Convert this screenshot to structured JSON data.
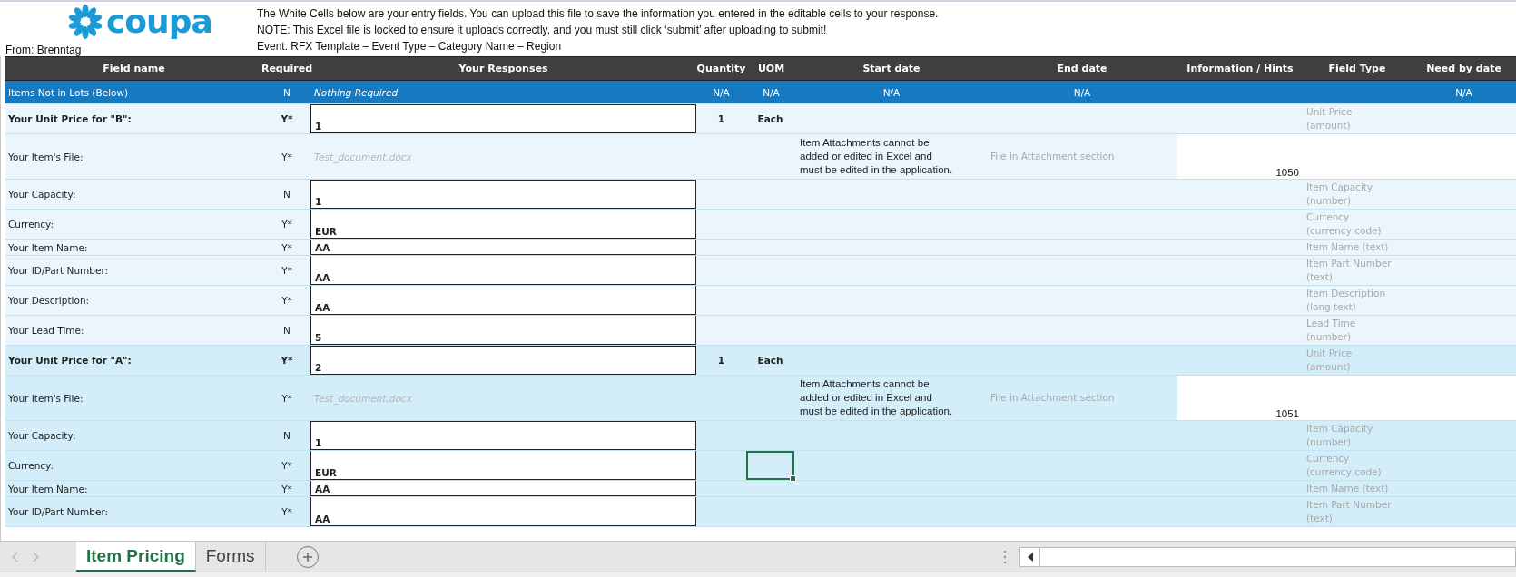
{
  "logo": {
    "text": "coupa"
  },
  "from": "From: Brenntag",
  "notes": [
    "The White Cells below are your entry fields. You can upload this file to save the information you entered in the editable cells to your response.",
    "NOTE: This Excel file is locked to ensure it uploads correctly, and you must still click ‘submit’ after uploading to submit!"
  ],
  "event": "Event: RFX Template – Event Type – Category Name – Region",
  "columns": [
    "Field name",
    "Required",
    "Your Responses",
    "Quantity",
    "UOM",
    "Start date",
    "End date",
    "Information / Hints",
    "Field Type",
    "Need by date"
  ],
  "lots_row": {
    "field": "Items Not in Lots (Below)",
    "required": "N",
    "response": "Nothing Required",
    "quantity": "N/A",
    "uom": "N/A",
    "start_date": "N/A",
    "end_date": "N/A",
    "need_by_date": "N/A"
  },
  "groups": [
    {
      "color": "#eaf6fc",
      "rows": [
        {
          "kind": "price",
          "label": "Your Unit Price for \"B\":",
          "required": "Y*",
          "response": "1",
          "quantity": "1",
          "uom": "Each",
          "field_type": "Unit Price\n(amount)",
          "selected": false
        },
        {
          "kind": "file",
          "label": "Your Item's File:",
          "required": "Y*",
          "file_name": "Test_document.docx",
          "note": "Item Attachments cannot be\nadded or edited in Excel and\nmust be edited in the application.",
          "hint": "File in Attachment section",
          "item_id": "1050",
          "selected": false
        },
        {
          "kind": "field",
          "label": "Your Capacity:",
          "required": "N",
          "response": "1",
          "field_type": "Item Capacity\n(number)",
          "selected": false
        },
        {
          "kind": "field",
          "label": "Currency:",
          "required": "Y*",
          "response": "EUR",
          "field_type": "Currency\n(currency code)",
          "selected": false
        },
        {
          "kind": "compact",
          "label": "Your Item Name:",
          "required": "Y*",
          "response": "AA",
          "field_type": "Item Name (text)",
          "selected": false
        },
        {
          "kind": "field",
          "label": "Your ID/Part Number:",
          "required": "Y*",
          "response": "AA",
          "field_type": "Item Part Number\n(text)",
          "selected": false
        },
        {
          "kind": "field",
          "label": "Your Description:",
          "required": "Y*",
          "response": "AA",
          "field_type": "Item Description\n(long text)",
          "selected": false
        },
        {
          "kind": "field",
          "label": "Your Lead Time:",
          "required": "N",
          "response": "5",
          "field_type": "Lead Time\n(number)",
          "selected": false
        }
      ]
    },
    {
      "color": "#d3eef9",
      "rows": [
        {
          "kind": "price",
          "label": "Your Unit Price for \"A\":",
          "required": "Y*",
          "response": "2",
          "quantity": "1",
          "uom": "Each",
          "field_type": "Unit Price\n(amount)",
          "selected": false
        },
        {
          "kind": "file",
          "label": "Your Item's File:",
          "required": "Y*",
          "file_name": "Test_document.docx",
          "note": "Item Attachments cannot be\nadded or edited in Excel and\nmust be edited in the application.",
          "hint": "File in Attachment section",
          "item_id": "1051",
          "selected": false
        },
        {
          "kind": "field",
          "label": "Your Capacity:",
          "required": "N",
          "response": "1",
          "field_type": "Item Capacity\n(number)",
          "selected": false
        },
        {
          "kind": "field",
          "label": "Currency:",
          "required": "Y*",
          "response": "EUR",
          "field_type": "Currency\n(currency code)",
          "selected": true
        },
        {
          "kind": "compact",
          "label": "Your Item Name:",
          "required": "Y*",
          "response": "AA",
          "field_type": "Item Name (text)",
          "selected": false
        },
        {
          "kind": "field",
          "label": "Your ID/Part Number:",
          "required": "Y*",
          "response": "AA",
          "field_type": "Item Part Number\n(text)",
          "selected": false
        }
      ]
    }
  ],
  "tabs": [
    {
      "label": "Item Pricing",
      "selected": true
    },
    {
      "label": "Forms",
      "selected": false
    }
  ]
}
